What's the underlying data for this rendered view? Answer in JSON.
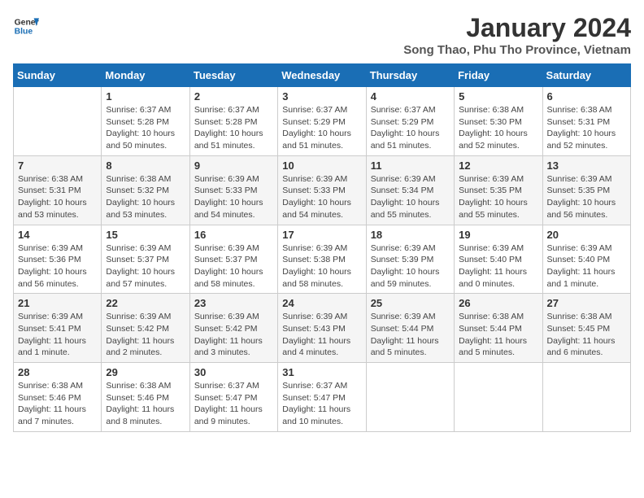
{
  "header": {
    "logo_line1": "General",
    "logo_line2": "Blue",
    "title": "January 2024",
    "subtitle": "Song Thao, Phu Tho Province, Vietnam"
  },
  "calendar": {
    "days_of_week": [
      "Sunday",
      "Monday",
      "Tuesday",
      "Wednesday",
      "Thursday",
      "Friday",
      "Saturday"
    ],
    "weeks": [
      [
        {
          "day": "",
          "info": ""
        },
        {
          "day": "1",
          "info": "Sunrise: 6:37 AM\nSunset: 5:28 PM\nDaylight: 10 hours\nand 50 minutes."
        },
        {
          "day": "2",
          "info": "Sunrise: 6:37 AM\nSunset: 5:28 PM\nDaylight: 10 hours\nand 51 minutes."
        },
        {
          "day": "3",
          "info": "Sunrise: 6:37 AM\nSunset: 5:29 PM\nDaylight: 10 hours\nand 51 minutes."
        },
        {
          "day": "4",
          "info": "Sunrise: 6:37 AM\nSunset: 5:29 PM\nDaylight: 10 hours\nand 51 minutes."
        },
        {
          "day": "5",
          "info": "Sunrise: 6:38 AM\nSunset: 5:30 PM\nDaylight: 10 hours\nand 52 minutes."
        },
        {
          "day": "6",
          "info": "Sunrise: 6:38 AM\nSunset: 5:31 PM\nDaylight: 10 hours\nand 52 minutes."
        }
      ],
      [
        {
          "day": "7",
          "info": "Sunrise: 6:38 AM\nSunset: 5:31 PM\nDaylight: 10 hours\nand 53 minutes."
        },
        {
          "day": "8",
          "info": "Sunrise: 6:38 AM\nSunset: 5:32 PM\nDaylight: 10 hours\nand 53 minutes."
        },
        {
          "day": "9",
          "info": "Sunrise: 6:39 AM\nSunset: 5:33 PM\nDaylight: 10 hours\nand 54 minutes."
        },
        {
          "day": "10",
          "info": "Sunrise: 6:39 AM\nSunset: 5:33 PM\nDaylight: 10 hours\nand 54 minutes."
        },
        {
          "day": "11",
          "info": "Sunrise: 6:39 AM\nSunset: 5:34 PM\nDaylight: 10 hours\nand 55 minutes."
        },
        {
          "day": "12",
          "info": "Sunrise: 6:39 AM\nSunset: 5:35 PM\nDaylight: 10 hours\nand 55 minutes."
        },
        {
          "day": "13",
          "info": "Sunrise: 6:39 AM\nSunset: 5:35 PM\nDaylight: 10 hours\nand 56 minutes."
        }
      ],
      [
        {
          "day": "14",
          "info": "Sunrise: 6:39 AM\nSunset: 5:36 PM\nDaylight: 10 hours\nand 56 minutes."
        },
        {
          "day": "15",
          "info": "Sunrise: 6:39 AM\nSunset: 5:37 PM\nDaylight: 10 hours\nand 57 minutes."
        },
        {
          "day": "16",
          "info": "Sunrise: 6:39 AM\nSunset: 5:37 PM\nDaylight: 10 hours\nand 58 minutes."
        },
        {
          "day": "17",
          "info": "Sunrise: 6:39 AM\nSunset: 5:38 PM\nDaylight: 10 hours\nand 58 minutes."
        },
        {
          "day": "18",
          "info": "Sunrise: 6:39 AM\nSunset: 5:39 PM\nDaylight: 10 hours\nand 59 minutes."
        },
        {
          "day": "19",
          "info": "Sunrise: 6:39 AM\nSunset: 5:40 PM\nDaylight: 11 hours\nand 0 minutes."
        },
        {
          "day": "20",
          "info": "Sunrise: 6:39 AM\nSunset: 5:40 PM\nDaylight: 11 hours\nand 1 minute."
        }
      ],
      [
        {
          "day": "21",
          "info": "Sunrise: 6:39 AM\nSunset: 5:41 PM\nDaylight: 11 hours\nand 1 minute."
        },
        {
          "day": "22",
          "info": "Sunrise: 6:39 AM\nSunset: 5:42 PM\nDaylight: 11 hours\nand 2 minutes."
        },
        {
          "day": "23",
          "info": "Sunrise: 6:39 AM\nSunset: 5:42 PM\nDaylight: 11 hours\nand 3 minutes."
        },
        {
          "day": "24",
          "info": "Sunrise: 6:39 AM\nSunset: 5:43 PM\nDaylight: 11 hours\nand 4 minutes."
        },
        {
          "day": "25",
          "info": "Sunrise: 6:39 AM\nSunset: 5:44 PM\nDaylight: 11 hours\nand 5 minutes."
        },
        {
          "day": "26",
          "info": "Sunrise: 6:38 AM\nSunset: 5:44 PM\nDaylight: 11 hours\nand 5 minutes."
        },
        {
          "day": "27",
          "info": "Sunrise: 6:38 AM\nSunset: 5:45 PM\nDaylight: 11 hours\nand 6 minutes."
        }
      ],
      [
        {
          "day": "28",
          "info": "Sunrise: 6:38 AM\nSunset: 5:46 PM\nDaylight: 11 hours\nand 7 minutes."
        },
        {
          "day": "29",
          "info": "Sunrise: 6:38 AM\nSunset: 5:46 PM\nDaylight: 11 hours\nand 8 minutes."
        },
        {
          "day": "30",
          "info": "Sunrise: 6:37 AM\nSunset: 5:47 PM\nDaylight: 11 hours\nand 9 minutes."
        },
        {
          "day": "31",
          "info": "Sunrise: 6:37 AM\nSunset: 5:47 PM\nDaylight: 11 hours\nand 10 minutes."
        },
        {
          "day": "",
          "info": ""
        },
        {
          "day": "",
          "info": ""
        },
        {
          "day": "",
          "info": ""
        }
      ]
    ]
  }
}
